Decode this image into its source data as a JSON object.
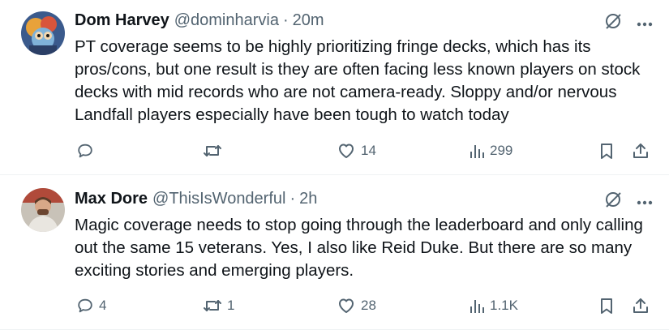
{
  "tweets": [
    {
      "name": "Dom Harvey",
      "handle": "@dominharvia",
      "separator": "·",
      "time": "20m",
      "text": "PT coverage seems to be highly prioritizing fringe decks, which has its pros/cons, but one result is they are often facing less known players on stock decks with mid records who are not camera-ready. Sloppy and/or nervous Landfall players especially have been tough to watch today",
      "replies": "",
      "retweets": "",
      "likes": "14",
      "views": "299"
    },
    {
      "name": "Max Dore",
      "handle": "@ThisIsWonderful",
      "separator": "·",
      "time": "2h",
      "text": "Magic coverage needs to stop going through the leaderboard and only calling out the same 15 veterans. Yes, I also like Reid Duke. But there are so many exciting stories and emerging players.",
      "replies": "4",
      "retweets": "1",
      "likes": "28",
      "views": "1.1K"
    }
  ],
  "icons": {
    "top": [
      "grok-icon",
      "more-icon"
    ],
    "actions": [
      "reply-icon",
      "retweet-icon",
      "like-icon",
      "views-icon",
      "bookmark-icon",
      "share-icon"
    ]
  },
  "colors": {
    "text": "#0f1419",
    "secondary": "#536471",
    "divider": "#eff3f4"
  }
}
